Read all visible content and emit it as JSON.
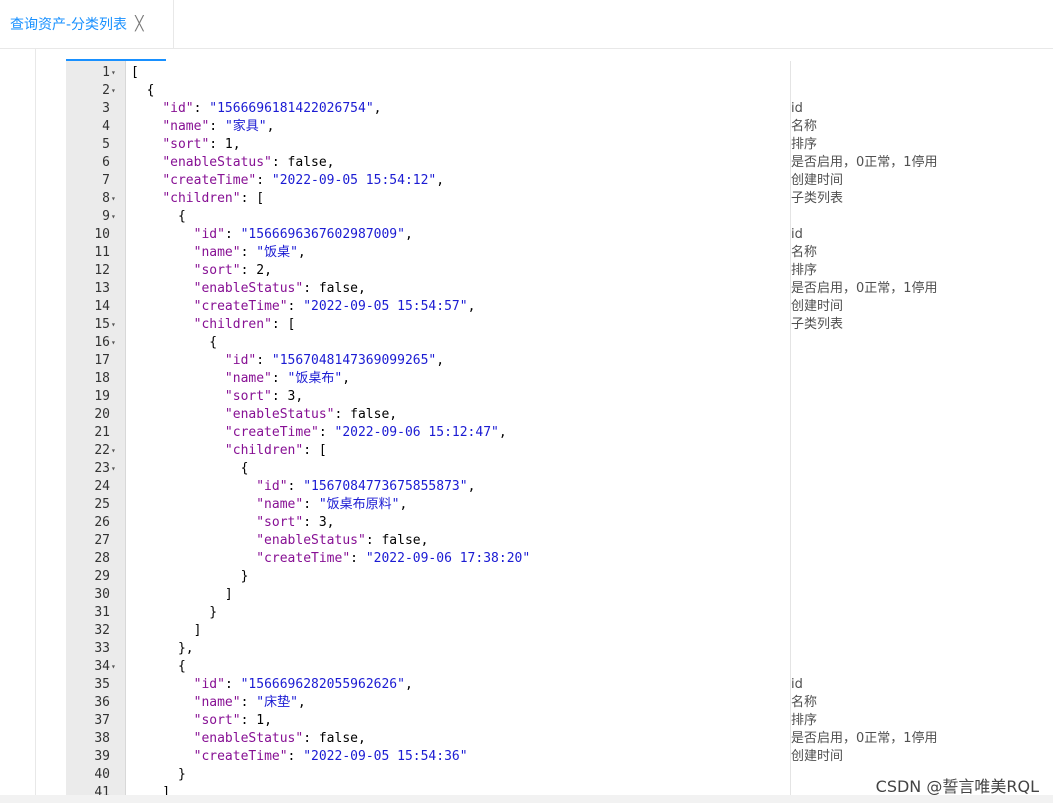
{
  "tab": {
    "title": "查询资产-分类列表",
    "close": "╳"
  },
  "lines": [
    {
      "n": "1",
      "fold": "▾",
      "code": "[",
      "comment": ""
    },
    {
      "n": "2",
      "fold": "▾",
      "code": "  {",
      "comment": ""
    },
    {
      "n": "3",
      "fold": "",
      "code": "    \"id\": \"1566696181422026754\",",
      "comment": "id"
    },
    {
      "n": "4",
      "fold": "",
      "code": "    \"name\": \"家具\",",
      "comment": "名称"
    },
    {
      "n": "5",
      "fold": "",
      "code": "    \"sort\": 1,",
      "comment": "排序"
    },
    {
      "n": "6",
      "fold": "",
      "code": "    \"enableStatus\": false,",
      "comment": "是否启用，0正常，1停用"
    },
    {
      "n": "7",
      "fold": "",
      "code": "    \"createTime\": \"2022-09-05 15:54:12\",",
      "comment": "创建时间"
    },
    {
      "n": "8",
      "fold": "▾",
      "code": "    \"children\": [",
      "comment": "子类列表"
    },
    {
      "n": "9",
      "fold": "▾",
      "code": "      {",
      "comment": ""
    },
    {
      "n": "10",
      "fold": "",
      "code": "        \"id\": \"1566696367602987009\",",
      "comment": "id"
    },
    {
      "n": "11",
      "fold": "",
      "code": "        \"name\": \"饭桌\",",
      "comment": "名称"
    },
    {
      "n": "12",
      "fold": "",
      "code": "        \"sort\": 2,",
      "comment": "排序"
    },
    {
      "n": "13",
      "fold": "",
      "code": "        \"enableStatus\": false,",
      "comment": "是否启用，0正常，1停用"
    },
    {
      "n": "14",
      "fold": "",
      "code": "        \"createTime\": \"2022-09-05 15:54:57\",",
      "comment": "创建时间"
    },
    {
      "n": "15",
      "fold": "▾",
      "code": "        \"children\": [",
      "comment": "子类列表"
    },
    {
      "n": "16",
      "fold": "▾",
      "code": "          {",
      "comment": ""
    },
    {
      "n": "17",
      "fold": "",
      "code": "            \"id\": \"1567048147369099265\",",
      "comment": ""
    },
    {
      "n": "18",
      "fold": "",
      "code": "            \"name\": \"饭桌布\",",
      "comment": ""
    },
    {
      "n": "19",
      "fold": "",
      "code": "            \"sort\": 3,",
      "comment": ""
    },
    {
      "n": "20",
      "fold": "",
      "code": "            \"enableStatus\": false,",
      "comment": ""
    },
    {
      "n": "21",
      "fold": "",
      "code": "            \"createTime\": \"2022-09-06 15:12:47\",",
      "comment": ""
    },
    {
      "n": "22",
      "fold": "▾",
      "code": "            \"children\": [",
      "comment": ""
    },
    {
      "n": "23",
      "fold": "▾",
      "code": "              {",
      "comment": ""
    },
    {
      "n": "24",
      "fold": "",
      "code": "                \"id\": \"1567084773675855873\",",
      "comment": ""
    },
    {
      "n": "25",
      "fold": "",
      "code": "                \"name\": \"饭桌布原料\",",
      "comment": ""
    },
    {
      "n": "26",
      "fold": "",
      "code": "                \"sort\": 3,",
      "comment": ""
    },
    {
      "n": "27",
      "fold": "",
      "code": "                \"enableStatus\": false,",
      "comment": ""
    },
    {
      "n": "28",
      "fold": "",
      "code": "                \"createTime\": \"2022-09-06 17:38:20\"",
      "comment": ""
    },
    {
      "n": "29",
      "fold": "",
      "code": "              }",
      "comment": ""
    },
    {
      "n": "30",
      "fold": "",
      "code": "            ]",
      "comment": ""
    },
    {
      "n": "31",
      "fold": "",
      "code": "          }",
      "comment": ""
    },
    {
      "n": "32",
      "fold": "",
      "code": "        ]",
      "comment": ""
    },
    {
      "n": "33",
      "fold": "",
      "code": "      },",
      "comment": ""
    },
    {
      "n": "34",
      "fold": "▾",
      "code": "      {",
      "comment": ""
    },
    {
      "n": "35",
      "fold": "",
      "code": "        \"id\": \"1566696282055962626\",",
      "comment": "id"
    },
    {
      "n": "36",
      "fold": "",
      "code": "        \"name\": \"床垫\",",
      "comment": "名称"
    },
    {
      "n": "37",
      "fold": "",
      "code": "        \"sort\": 1,",
      "comment": "排序"
    },
    {
      "n": "38",
      "fold": "",
      "code": "        \"enableStatus\": false,",
      "comment": "是否启用，0正常，1停用"
    },
    {
      "n": "39",
      "fold": "",
      "code": "        \"createTime\": \"2022-09-05 15:54:36\"",
      "comment": "创建时间"
    },
    {
      "n": "40",
      "fold": "",
      "code": "      }",
      "comment": ""
    },
    {
      "n": "41",
      "fold": "",
      "code": "    ]",
      "comment": ""
    }
  ],
  "watermark": "CSDN @誓言唯美RQL",
  "colors": {
    "accent": "#1890ff",
    "key": "#871094",
    "string": "#1b1bd3",
    "gutter": "#ebebeb"
  }
}
